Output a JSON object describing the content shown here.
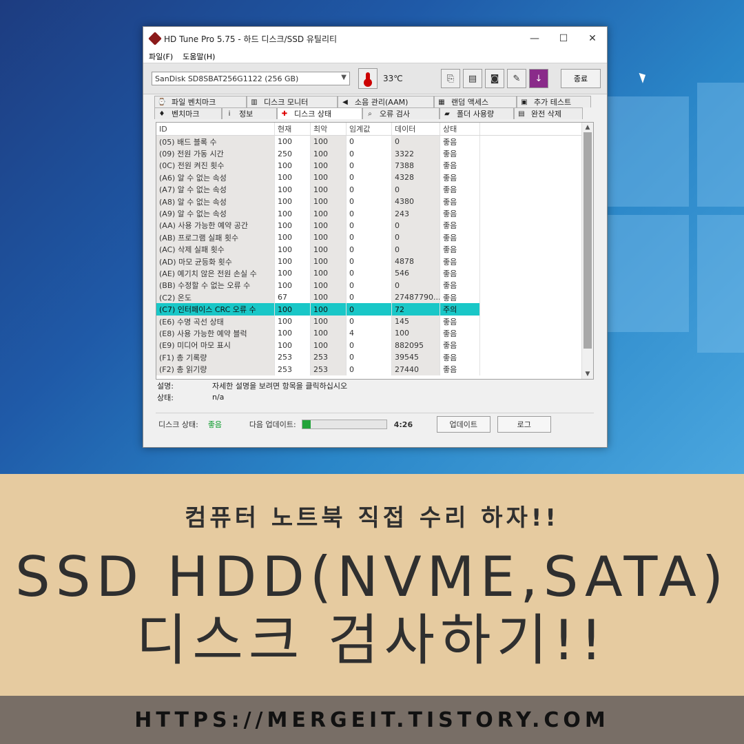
{
  "window": {
    "title": "HD Tune Pro 5.75 - 하드 디스크/SSD 유틸리티",
    "controls": [
      "—",
      "☐",
      "✕"
    ],
    "menu": [
      "파일(F)",
      "도움말(H)"
    ]
  },
  "toolbar": {
    "drive": "SanDisk SD8SBAT256G1122 (256 GB)",
    "temperature": "33℃",
    "exit_label": "종료"
  },
  "tabs": {
    "top": [
      {
        "label": "파일 벤치마크",
        "icon": "file-benchmark-icon"
      },
      {
        "label": "디스크 모니터",
        "icon": "disk-monitor-icon"
      },
      {
        "label": "소음 관리(AAM)",
        "icon": "speaker-icon"
      },
      {
        "label": "랜덤 액세스",
        "icon": "random-access-icon"
      },
      {
        "label": "추가 테스트",
        "icon": "extra-test-icon"
      }
    ],
    "bottom": [
      {
        "label": "벤치마크",
        "icon": "benchmark-icon"
      },
      {
        "label": "정보",
        "icon": "info-icon"
      },
      {
        "label": "디스크 상태",
        "icon": "health-cross-icon",
        "active": true
      },
      {
        "label": "오류 검사",
        "icon": "error-scan-icon"
      },
      {
        "label": "폴더 사용량",
        "icon": "folder-icon"
      },
      {
        "label": "완전 삭제",
        "icon": "erase-icon"
      }
    ]
  },
  "grid": {
    "headers": [
      "ID",
      "현재",
      "최악",
      "임계값",
      "데이터",
      "상태"
    ],
    "rows": [
      [
        "(05) 배드 블록 수",
        "100",
        "100",
        "0",
        "0",
        "좋음"
      ],
      [
        "(09) 전원 가동 시간",
        "250",
        "100",
        "0",
        "3322",
        "좋음"
      ],
      [
        "(0C) 전원 켜진 횟수",
        "100",
        "100",
        "0",
        "7388",
        "좋음"
      ],
      [
        "(A6) 알 수 없는 속성",
        "100",
        "100",
        "0",
        "4328",
        "좋음"
      ],
      [
        "(A7) 알 수 없는 속성",
        "100",
        "100",
        "0",
        "0",
        "좋음"
      ],
      [
        "(A8) 알 수 없는 속성",
        "100",
        "100",
        "0",
        "4380",
        "좋음"
      ],
      [
        "(A9) 알 수 없는 속성",
        "100",
        "100",
        "0",
        "243",
        "좋음"
      ],
      [
        "(AA) 사용 가능한 예약 공간",
        "100",
        "100",
        "0",
        "0",
        "좋음"
      ],
      [
        "(AB) 프로그램 실패 횟수",
        "100",
        "100",
        "0",
        "0",
        "좋음"
      ],
      [
        "(AC) 삭제 실패 횟수",
        "100",
        "100",
        "0",
        "0",
        "좋음"
      ],
      [
        "(AD) 마모 균등화 횟수",
        "100",
        "100",
        "0",
        "4878",
        "좋음"
      ],
      [
        "(AE) 예기치 않은 전원 손실 수",
        "100",
        "100",
        "0",
        "546",
        "좋음"
      ],
      [
        "(BB) 수정할 수 없는 오류 수",
        "100",
        "100",
        "0",
        "0",
        "좋음"
      ],
      [
        "(C2) 온도",
        "67",
        "100",
        "0",
        "27487790...",
        "좋음"
      ],
      [
        "(C7) 인터페이스 CRC 오류 수",
        "100",
        "100",
        "0",
        "72",
        "주의"
      ],
      [
        "(E6) 수명 곡선 상태",
        "100",
        "100",
        "0",
        "145",
        "좋음"
      ],
      [
        "(E8) 사용 가능한 예약 블럭",
        "100",
        "100",
        "4",
        "100",
        "좋음"
      ],
      [
        "(E9) 미디어 마모 표시",
        "100",
        "100",
        "0",
        "882095",
        "좋음"
      ],
      [
        "(F1) 총 기록량",
        "253",
        "253",
        "0",
        "39545",
        "좋음"
      ],
      [
        "(F2) 총 읽기량",
        "253",
        "253",
        "0",
        "27440",
        "좋음"
      ]
    ],
    "warning_row_index": 14,
    "warning_color": "#19c7c7"
  },
  "details": {
    "desc_label": "설명:",
    "desc_value": "자세한 설명을 보려면 항목을 클릭하십시오",
    "status_label": "상태:",
    "status_value": "n/a"
  },
  "statusbar": {
    "disk_status_label": "디스크 상태:",
    "disk_status_value": "좋음",
    "next_update_label": "다음 업데이트:",
    "progress": 0.1,
    "timer": "4:26",
    "update_label": "업데이트",
    "log_label": "로그"
  },
  "banner": {
    "subtitle": "컴퓨터 노트북 직접 수리 하자!!",
    "line1": "SSD HDD(NVME,SATA)",
    "line2": "디스크 검사하기!!",
    "url": "HTTPS://MERGEIT.TISTORY.COM"
  }
}
